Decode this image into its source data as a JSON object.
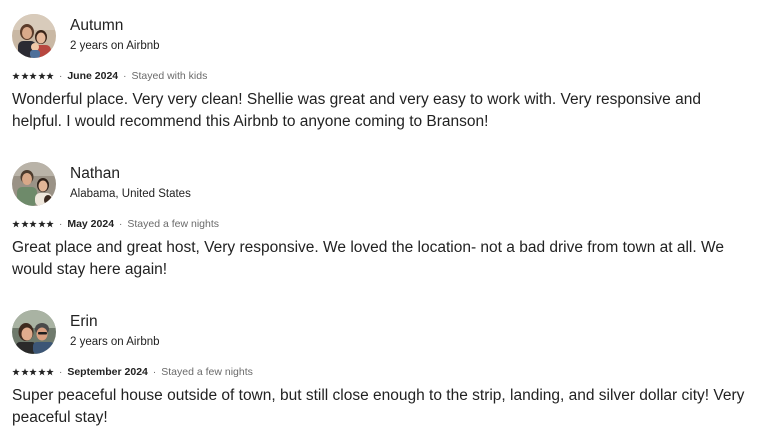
{
  "reviews": [
    {
      "name": "Autumn",
      "subtitle": "2 years on Airbnb",
      "rating": 5,
      "date": "June 2024",
      "stay_type": "Stayed with kids",
      "text": "Wonderful place. Very very clean! Shellie was great and very easy to work with. Very responsive and helpful. I would recommend this Airbnb to anyone coming to Branson!"
    },
    {
      "name": "Nathan",
      "subtitle": "Alabama, United States",
      "rating": 5,
      "date": "May 2024",
      "stay_type": "Stayed a few nights",
      "text": "Great place and great host, Very responsive. We loved the location- not a bad drive from town at all. We would stay here again!"
    },
    {
      "name": "Erin",
      "subtitle": "2 years on Airbnb",
      "rating": 5,
      "date": "September 2024",
      "stay_type": "Stayed a few nights",
      "text": "Super peaceful house outside of town, but still close enough to the strip, landing, and silver dollar city! Very peaceful stay!"
    }
  ],
  "separator": "·",
  "colors": {
    "text": "#222222",
    "muted": "#6a6a6a",
    "star": "#222222"
  },
  "icons": {
    "star": "star-icon",
    "avatar": "avatar-photo"
  }
}
